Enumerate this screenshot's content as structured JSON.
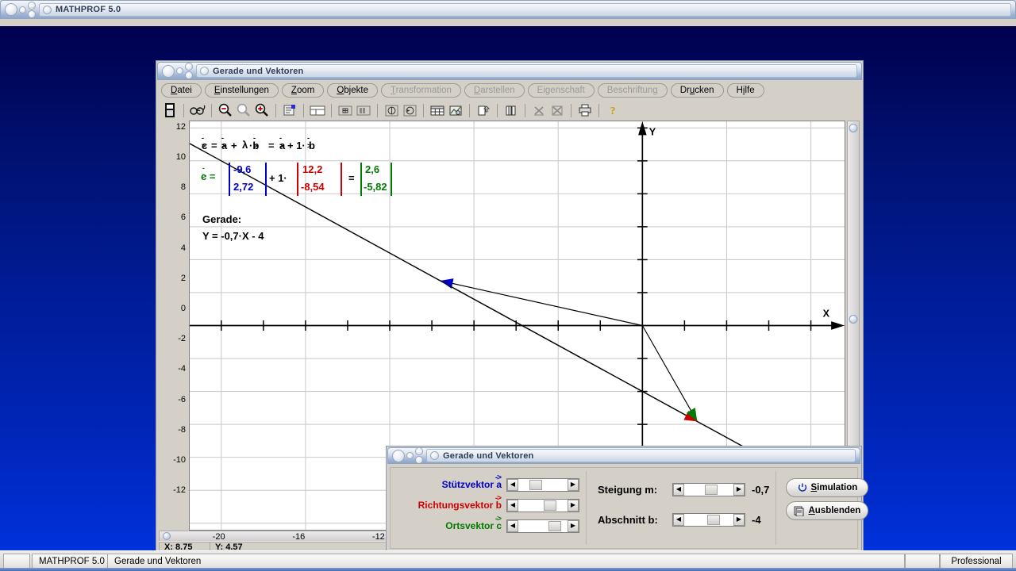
{
  "root_window": {
    "title": "MATHPROF 5.0"
  },
  "child_window": {
    "title": "Gerade und Vektoren"
  },
  "menu": {
    "items": [
      {
        "label": "Datei",
        "enabled": true
      },
      {
        "label": "Einstellungen",
        "enabled": true
      },
      {
        "label": "Zoom",
        "enabled": true
      },
      {
        "label": "Objekte",
        "enabled": true
      },
      {
        "label": "Transformation",
        "enabled": false
      },
      {
        "label": "Darstellen",
        "enabled": false
      },
      {
        "label": "Eigenschaft",
        "enabled": false
      },
      {
        "label": "Beschriftung",
        "enabled": false
      },
      {
        "label": "Drucken",
        "enabled": true
      },
      {
        "label": "Hilfe",
        "enabled": true
      }
    ]
  },
  "toolbar": {
    "buttons": [
      "calculator-icon",
      "glasses-icon",
      "zoom-out-icon",
      "zoom-reset-icon",
      "zoom-in-icon",
      "properties-icon",
      "window-split-icon",
      "grid-toggle-icon",
      "columns-icon",
      "info-circle-icon",
      "refresh-circle-icon",
      "table-icon",
      "chart-image-icon",
      "page-export-icon",
      "copy-icon",
      "delete-x-icon",
      "delete-all-x-icon",
      "print-icon",
      "help-icon"
    ]
  },
  "plot": {
    "x_axis_label": "X",
    "y_axis_label": "Y",
    "formula_top": "c = a + λ ·b = a + 1·b",
    "line_caption": "Gerade:",
    "line_equation": "Y = -0,7·X - 4",
    "vector_c_label": "c =",
    "matrix": {
      "a_top": "-9,6",
      "a_bottom": "2,72",
      "operator": "+ 1·",
      "b_top": "12,2",
      "b_bottom": "-8,54",
      "equals": "=",
      "c_top": "2,6",
      "c_bottom": "-5,82"
    },
    "colors": {
      "vector_a": "#0000cc",
      "vector_b": "#cc0000",
      "vector_c": "#007a00",
      "axis": "#000000",
      "grid": "#cccccc"
    }
  },
  "chart_data": {
    "type": "line",
    "title": "Gerade und Vektoren",
    "xlabel": "X",
    "ylabel": "Y",
    "xlim": [
      -21.5,
      9.6
    ],
    "ylim": [
      -12.4,
      12.4
    ],
    "x_ticks": [
      -20,
      -16,
      -12
    ],
    "x_tick_step": 2,
    "y_ticks": [
      12,
      10,
      8,
      6,
      4,
      2,
      0,
      -2,
      -4,
      -6,
      -8,
      -10,
      -12
    ],
    "grid": true,
    "line": {
      "name": "Gerade",
      "slope": -0.7,
      "intercept": -4,
      "equation": "Y = -0,7·X - 4"
    },
    "vectors": [
      {
        "name": "Stützvektor a",
        "symbol": "a",
        "color": "#0000cc",
        "from": [
          0,
          0
        ],
        "to": [
          -9.6,
          2.72
        ]
      },
      {
        "name": "Richtungsvektor b",
        "symbol": "b",
        "color": "#cc0000",
        "from": [
          -9.6,
          2.72
        ],
        "to": [
          2.6,
          -5.82
        ]
      },
      {
        "name": "Ortsvektor c",
        "symbol": "c",
        "color": "#007a00",
        "from": [
          0,
          0
        ],
        "to": [
          2.6,
          -5.82
        ]
      }
    ]
  },
  "status": {
    "x_readout": "X: 8.75",
    "y_readout": "Y: 4.57"
  },
  "dialog": {
    "title": "Gerade und Vektoren",
    "vectors": [
      {
        "label": "Stützvektor a",
        "color": "#0000cc",
        "thumb_pct": 22
      },
      {
        "label": "Richtungsvektor b",
        "color": "#cc0000",
        "thumb_pct": 52
      },
      {
        "label": "Ortsvektor c",
        "color": "#007a00",
        "thumb_pct": 62
      }
    ],
    "params": [
      {
        "label": "Steigung m:",
        "value": "-0,7",
        "thumb_pct": 42
      },
      {
        "label": "Abschnitt b:",
        "value": "-4",
        "thumb_pct": 46
      }
    ],
    "buttons": [
      {
        "label": "Simulation",
        "icon": "power-refresh-icon",
        "accel": "S"
      },
      {
        "label": "Ausblenden",
        "icon": "hide-window-icon",
        "accel": "A"
      }
    ]
  },
  "taskbar": {
    "items": [
      {
        "label": "MATHPROF 5.0"
      },
      {
        "label": "Gerade und Vektoren"
      }
    ],
    "right_label": "Professional"
  }
}
